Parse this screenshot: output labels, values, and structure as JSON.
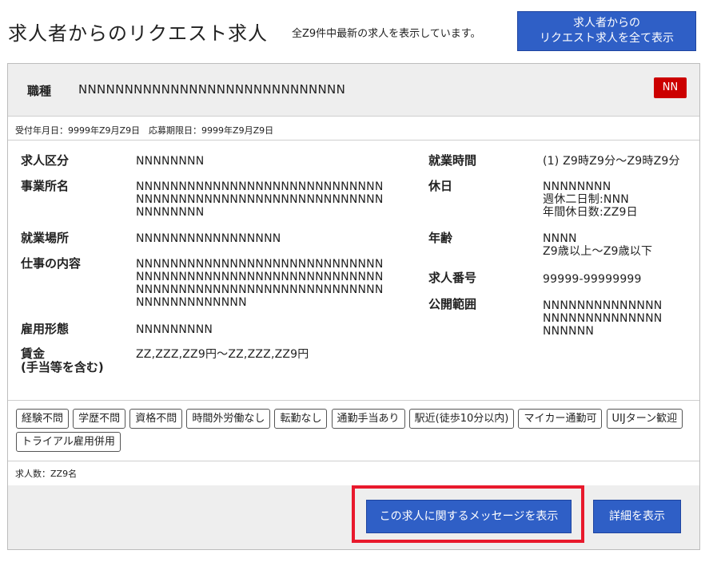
{
  "header": {
    "title": "求人者からのリクエスト求人",
    "subtitle": "全Z9件中最新の求人を表示しています。",
    "show_all_line1": "求人者からの",
    "show_all_line2": "リクエスト求人を全て表示"
  },
  "job": {
    "occupation_label": "職種",
    "occupation_value": "NNNNNNNNNNNNNNNNNNNNNNNNNNNNN",
    "badge": "NN",
    "dates": "受付年月日：9999年Z9月Z9日　応募期限日：9999年Z9月Z9日"
  },
  "fields_left": {
    "category_label": "求人区分",
    "category_value": "NNNNNNNN",
    "office_label": "事業所名",
    "office_value": "NNNNNNNNNNNNNNNNNNNNNNNNNNNNN\nNNNNNNNNNNNNNNNNNNNNNNNNNNNNN\nNNNNNNNN",
    "workplace_label": "就業場所",
    "workplace_value": "NNNNNNNNNNNNNNNNN",
    "content_label": "仕事の内容",
    "content_value": "NNNNNNNNNNNNNNNNNNNNNNNNNNNNN\nNNNNNNNNNNNNNNNNNNNNNNNNNNNNN\nNNNNNNNNNNNNNNNNNNNNNNNNNNNNN\nNNNNNNNNNNNNN",
    "employment_label": "雇用形態",
    "employment_value": "NNNNNNNNN",
    "wage_label_line1": "賃金",
    "wage_label_line2": "(手当等を含む)",
    "wage_value": "ZZ,ZZZ,ZZ9円～ZZ,ZZZ,ZZ9円"
  },
  "fields_right": {
    "hours_label": "就業時間",
    "hours_value": "(1) Z9時Z9分～Z9時Z9分",
    "holiday_label": "休日",
    "holiday_value": "NNNNNNNN\n週休二日制:NNN\n年間休日数:ZZ9日",
    "age_label": "年齢",
    "age_value": "NNNN\nZ9歳以上～Z9歳以下",
    "number_label": "求人番号",
    "number_value": "99999-99999999",
    "scope_label": "公開範囲",
    "scope_value": "NNNNNNNNNNNNNN\nNNNNNNNNNNNNNN\nNNNNNN"
  },
  "tags": [
    "経験不問",
    "学歴不問",
    "資格不問",
    "時間外労働なし",
    "転勤なし",
    "通勤手当あり",
    "駅近(徒歩10分以内)",
    "マイカー通勤可",
    "UIJターン歓迎",
    "トライアル雇用併用"
  ],
  "count": "求人数：ZZ9名",
  "footer": {
    "message_button": "この求人に関するメッセージを表示",
    "detail_button": "詳細を表示"
  },
  "colors": {
    "primary_button": "#2f5fc6",
    "badge": "#cc0000",
    "highlight": "#e8192c"
  }
}
